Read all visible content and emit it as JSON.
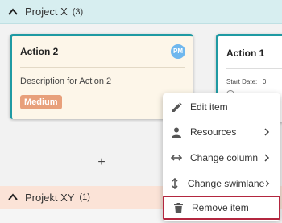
{
  "lanes": {
    "project_x": {
      "title": "Project X",
      "count": "(3)"
    },
    "projekt_xy": {
      "title": "Projekt XY",
      "count": "(1)"
    }
  },
  "cards": {
    "action2": {
      "title": "Action 2",
      "avatar": "PM",
      "description": "Description for Action 2",
      "priority": "Medium"
    },
    "action1": {
      "title": "Action 1",
      "start_label": "Start Date:",
      "start_value": "0"
    }
  },
  "add_label": "+",
  "context_menu": {
    "items": [
      {
        "label": "Edit item",
        "icon": "pencil-icon"
      },
      {
        "label": "Resources",
        "icon": "person-icon"
      },
      {
        "label": "Change column",
        "icon": "horizontal-arrows-icon"
      },
      {
        "label": "Change swimlane",
        "icon": "vertical-arrows-icon"
      },
      {
        "label": "Remove item",
        "icon": "trash-icon"
      }
    ]
  },
  "colors": {
    "lane_x_bg": "#d7eef0",
    "lane_xy_bg": "#fbe3d7",
    "card_border": "#1f9aa3",
    "priority_medium": "#e8a07b",
    "highlight_border": "#b3263f"
  }
}
